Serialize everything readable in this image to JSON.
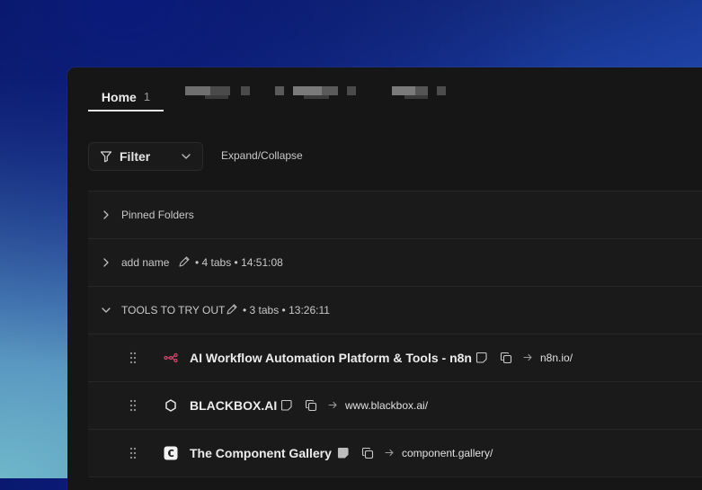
{
  "tabs": {
    "home_label": "Home",
    "home_count": "1"
  },
  "toolbar": {
    "filter_label": "Filter",
    "expand_label": "Expand/Collapse"
  },
  "folders": [
    {
      "title": "Pinned Folders",
      "expanded": false
    },
    {
      "title": "add name",
      "meta": "• 4 tabs • 14:51:08",
      "expanded": false
    },
    {
      "title": "TOOLS TO TRY OUT",
      "meta": "• 3 tabs • 13:26:11",
      "expanded": true
    }
  ],
  "tab_items": [
    {
      "title": "AI Workflow Automation Platform & Tools - n8n",
      "url": "n8n.io/",
      "favicon": "n8n-icon"
    },
    {
      "title": "BLACKBOX.AI",
      "url": "www.blackbox.ai/",
      "favicon": "blackbox-icon"
    },
    {
      "title": "The Component Gallery",
      "url": "component.gallery/",
      "favicon": "component-gallery-icon"
    }
  ]
}
